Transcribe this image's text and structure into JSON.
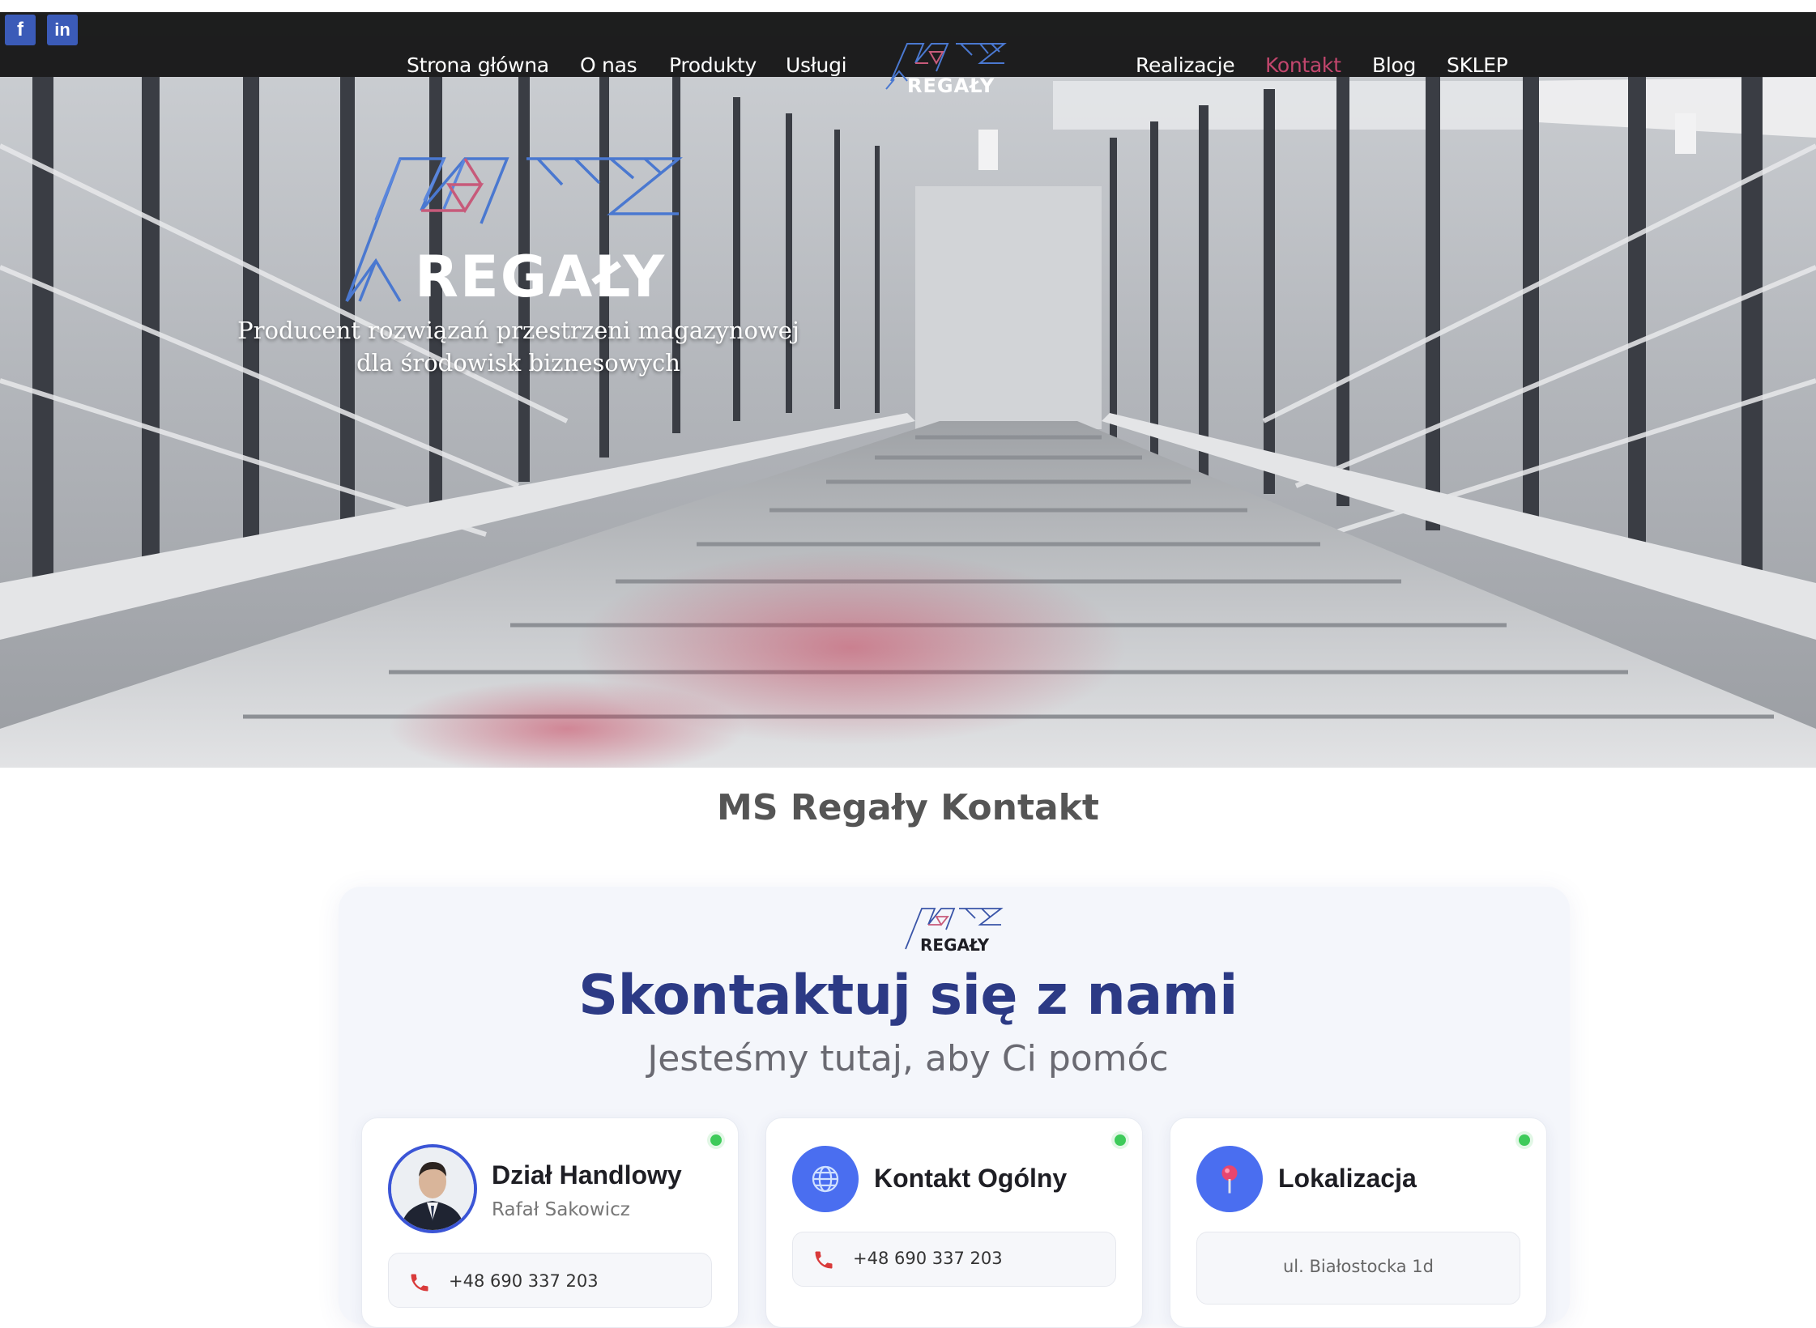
{
  "social": {
    "facebook": "f",
    "linkedin": "in"
  },
  "nav": {
    "left": [
      "Strona główna",
      "O nas",
      "Produkty",
      "Usługi"
    ],
    "right": [
      "Realizacje",
      "Kontakt",
      "Blog",
      "SKLEP"
    ],
    "active": "Kontakt",
    "logo_text": "REGAŁY"
  },
  "hero": {
    "logo_text": "REGAŁY",
    "tagline_line1": "Producent rozwiązań przestrzeni magazynowej",
    "tagline_line2": "dla środowisk biznesowych"
  },
  "page": {
    "title": "MS Regały Kontakt"
  },
  "contact": {
    "logo_text": "REGAŁY",
    "heading": "Skontaktuj się z nami",
    "subheading": "Jesteśmy tutaj, aby Ci pomóc",
    "cards": [
      {
        "title": "Dział Handlowy",
        "subtitle": "Rafał Sakowicz",
        "phone": "+48 690 337 203"
      },
      {
        "title": "Kontakt Ogólny",
        "phone": "+48 690 337 203"
      },
      {
        "title": "Lokalizacja",
        "address": "ul. Białostocka 1d"
      }
    ]
  },
  "colors": {
    "accent_active": "#c2466d",
    "heading_blue": "#2c3a85",
    "icon_blue": "#4a6ef0",
    "status_green": "#3ecb5a",
    "phone_red": "#d93a3a"
  }
}
